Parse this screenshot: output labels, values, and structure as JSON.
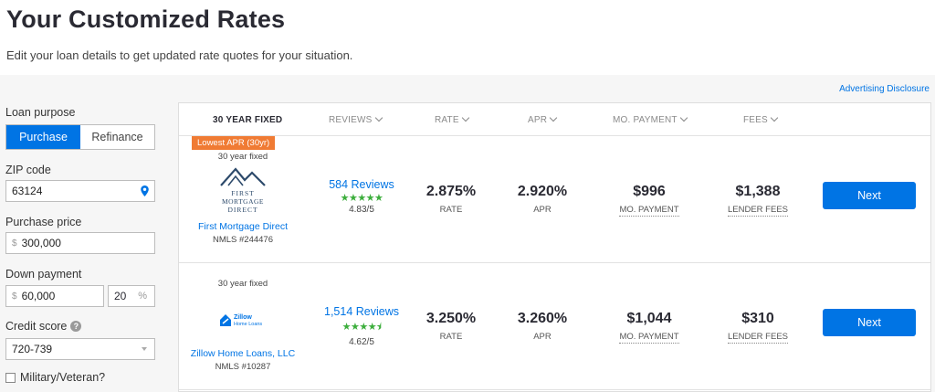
{
  "header": {
    "title": "Your Customized Rates",
    "subtitle": "Edit your loan details to get updated rate quotes for your situation."
  },
  "advertising_disclosure": "Advertising Disclosure",
  "form": {
    "loan_purpose": {
      "label": "Loan purpose",
      "options": [
        "Purchase",
        "Refinance"
      ],
      "selected": "Purchase"
    },
    "zip": {
      "label": "ZIP code",
      "value": "63124"
    },
    "purchase_price": {
      "label": "Purchase price",
      "prefix": "$",
      "value": "300,000"
    },
    "down_payment": {
      "label": "Down payment",
      "prefix": "$",
      "value": "60,000",
      "percent": "20",
      "percent_sign": "%"
    },
    "credit_score": {
      "label": "Credit score",
      "help": "?",
      "value": "720-739"
    },
    "military": {
      "label": "Military/Veteran?",
      "checked": false
    }
  },
  "table": {
    "columns": [
      "30 YEAR FIXED",
      "REVIEWS",
      "RATE",
      "APR",
      "MO. PAYMENT",
      "FEES"
    ],
    "rows": [
      {
        "badge": "Lowest APR (30yr)",
        "term": "30 year fixed",
        "logo_lines": [
          "FIRST",
          "MORTGAGE",
          "DIRECT"
        ],
        "lender": "First Mortgage Direct",
        "nmls": "NMLS #244476",
        "reviews": "584 Reviews",
        "stars": 5,
        "score": "4.83/5",
        "rate": "2.875%",
        "rate_caption": "RATE",
        "apr": "2.920%",
        "apr_caption": "APR",
        "payment": "$996",
        "payment_caption": "MO. PAYMENT",
        "fees": "$1,388",
        "fees_caption": "LENDER FEES",
        "button": "Next"
      },
      {
        "badge": "",
        "term": "30 year fixed",
        "logo_lines": [
          "Zillow",
          "Home Loans"
        ],
        "lender": "Zillow Home Loans, LLC",
        "nmls": "NMLS #10287",
        "reviews": "1,514 Reviews",
        "stars": 4.5,
        "score": "4.62/5",
        "rate": "3.250%",
        "rate_caption": "RATE",
        "apr": "3.260%",
        "apr_caption": "APR",
        "payment": "$1,044",
        "payment_caption": "MO. PAYMENT",
        "fees": "$310",
        "fees_caption": "LENDER FEES",
        "button": "Next"
      }
    ]
  },
  "colors": {
    "accent": "#0074e4",
    "badge": "#f07b34",
    "stars": "#3cae3c"
  }
}
